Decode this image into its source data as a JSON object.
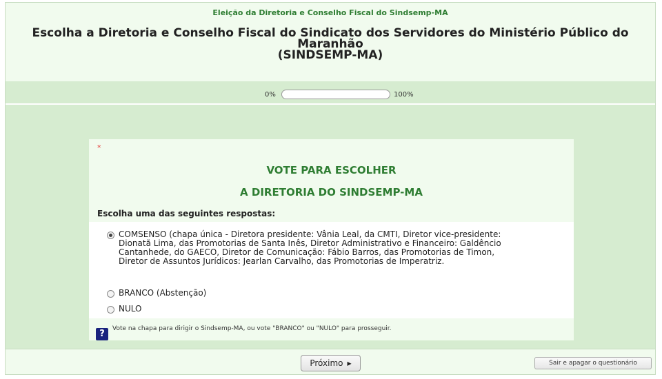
{
  "header": {
    "survey_name": "Eleição da Diretoria e Conselho Fiscal do Sindsemp-MA",
    "description_line1": "Escolha a Diretoria e Conselho Fiscal do Sindicato dos Servidores do Ministério Público do Maranhão",
    "description_line2": "(SINDSEMP-MA)"
  },
  "progress": {
    "min_label": "0%",
    "max_label": "100%",
    "value": 0
  },
  "question": {
    "required_marker": "*",
    "title_line1": "VOTE PARA ESCOLHER",
    "title_line2": "A DIRETORIA DO SINDSEMP-MA",
    "instruction": "Escolha uma das seguintes respostas:",
    "answers": [
      {
        "label": "COMSENSO (chapa única - Diretora presidente: Vânia Leal, da CMTI, Diretor vice-presidente: Dionatã Lima, das Promotorias de Santa Inês, Diretor Administrativo e Financeiro: Galdêncio Cantanhede, do GAECO, Diretor de Comunicação: Fábio Barros, das Promotorias de Timon, Diretor de Assuntos Jurídicos: Jearlan Carvalho, das Promotorias de Imperatriz.",
        "selected": true
      },
      {
        "label": "BRANCO (Abstenção)",
        "selected": false
      },
      {
        "label": "NULO",
        "selected": false
      }
    ],
    "help_icon": "question-mark-icon",
    "help_glyph": "?",
    "help_text": "Vote na chapa para dirigir o Sindsemp-MA, ou vote \"BRANCO\" ou \"NULO\" para prosseguir."
  },
  "footer": {
    "next_label": "Próximo",
    "next_arrow": "▶",
    "exit_label": "Sair e apagar o questionário"
  },
  "colors": {
    "accent_green": "#2e7d32",
    "panel_bg": "#f1fbee",
    "page_bg": "#d6ecd0",
    "help_icon_bg": "#1a237e"
  }
}
